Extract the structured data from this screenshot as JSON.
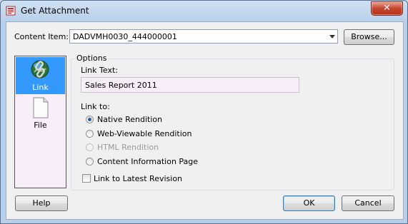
{
  "window": {
    "title": "Get Attachment",
    "close_glyph": "✕"
  },
  "content_item": {
    "label": "Content Item:",
    "value": "DADVMH0030_444000001",
    "browse_label": "Browse..."
  },
  "sidebar": {
    "items": [
      {
        "label": "Link",
        "icon": "link-globe-icon",
        "selected": true
      },
      {
        "label": "File",
        "icon": "file-icon",
        "selected": false
      }
    ]
  },
  "options": {
    "legend": "Options",
    "link_text_label": "Link Text:",
    "link_text_value": "Sales Report 2011",
    "link_to_label": "Link to:",
    "radios": [
      {
        "label": "Native Rendition",
        "checked": true,
        "disabled": false
      },
      {
        "label": "Web-Viewable Rendition",
        "checked": false,
        "disabled": false
      },
      {
        "label": "HTML Rendition",
        "checked": false,
        "disabled": true
      },
      {
        "label": "Content Information Page",
        "checked": false,
        "disabled": false
      }
    ],
    "checkbox": {
      "label": "Link to Latest Revision",
      "checked": false
    }
  },
  "buttons": {
    "help": "Help",
    "ok": "OK",
    "cancel": "Cancel"
  },
  "colors": {
    "selection": "#3399ff",
    "panel_bg": "#f8eef9",
    "title_bar": "#b9cfe9",
    "close_red": "#c7432c"
  }
}
